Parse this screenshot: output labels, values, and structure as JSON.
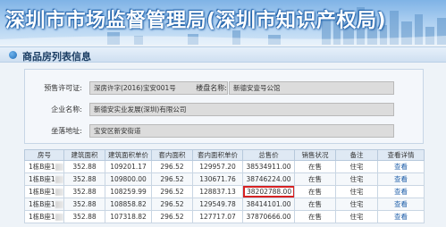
{
  "banner": {
    "title": "深圳市市场监督管理局(深圳市知识产权局)",
    "colors": {
      "sky_top": "#7fb3e6",
      "title_outline": "#1d5fa8"
    }
  },
  "panel": {
    "title": "商品房列表信息",
    "icon": "blue-dot-icon"
  },
  "form": {
    "presale_label": "预售许可证:",
    "presale_value": "深房许字(2016)宝安001号",
    "project_label": "楼盘名称:",
    "project_value": "新德安壹号公馆",
    "company_label": "企业名称:",
    "company_value": "新德安实业发展(深圳)有限公司",
    "address_label": "坐落地址:",
    "address_value": "宝安区新安街道"
  },
  "table": {
    "headers": [
      "房号",
      "建筑面积",
      "建筑面积单价",
      "套内面积",
      "套内面积单价",
      "总售价",
      "销售状况",
      "备注",
      "查看详情"
    ],
    "rows": [
      {
        "room": "1栋B座1",
        "gfa": "352.88",
        "gfa_price": "109201.17",
        "inner_area": "296.52",
        "inner_price": "129957.20",
        "total": "38534911.00",
        "status": "在售",
        "note": "住宅",
        "detail": "查看"
      },
      {
        "room": "1栋B座1",
        "gfa": "352.88",
        "gfa_price": "109800.00",
        "inner_area": "296.52",
        "inner_price": "130671.76",
        "total": "38746224.00",
        "status": "在售",
        "note": "住宅",
        "detail": "查看"
      },
      {
        "room": "1栋B座1",
        "gfa": "352.88",
        "gfa_price": "108259.99",
        "inner_area": "296.52",
        "inner_price": "128837.13",
        "total": "38202788.00",
        "status": "在售",
        "note": "住宅",
        "detail": "查看",
        "highlight": true
      },
      {
        "room": "1栋B座1",
        "gfa": "352.88",
        "gfa_price": "108858.82",
        "inner_area": "296.52",
        "inner_price": "129549.78",
        "total": "38414101.00",
        "status": "在售",
        "note": "住宅",
        "detail": "查看"
      },
      {
        "room": "1栋B座1",
        "gfa": "352.88",
        "gfa_price": "107318.82",
        "inner_area": "296.52",
        "inner_price": "127717.07",
        "total": "37870666.00",
        "status": "在售",
        "note": "住宅",
        "detail": "查看"
      }
    ],
    "colors": {
      "header_bg": "#dfe9f4",
      "link": "#1f5faa",
      "highlight_border": "#d62222"
    }
  }
}
